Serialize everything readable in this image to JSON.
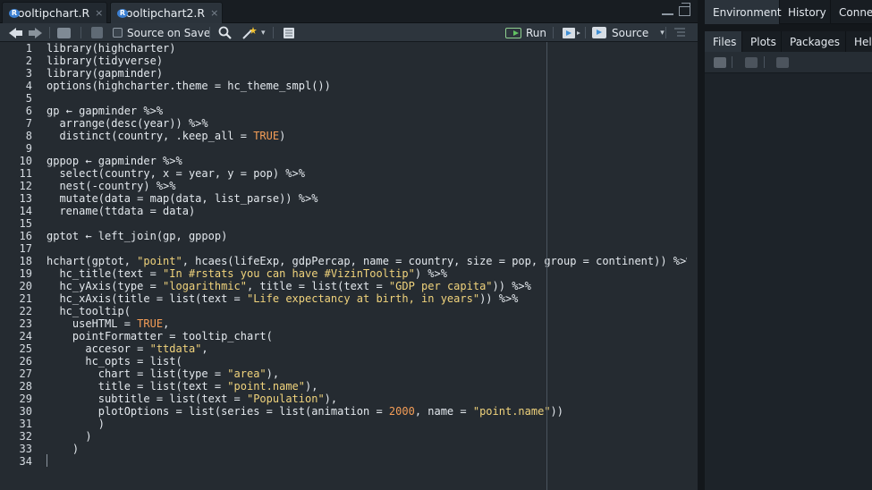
{
  "editor": {
    "tabs": [
      {
        "label": "tooltipchart.R",
        "close": "×"
      },
      {
        "label": "tooltipchart2.R",
        "close": "×"
      }
    ],
    "toolbar": {
      "source_on_save_label": "Source on Save",
      "run_label": "Run",
      "source_label": "Source",
      "source_caret": "▾"
    },
    "line_numbers": [
      "1",
      "2",
      "3",
      "4",
      "5",
      "6",
      "7",
      "8",
      "9",
      "10",
      "11",
      "12",
      "13",
      "14",
      "15",
      "16",
      "17",
      "18",
      "19",
      "20",
      "21",
      "22",
      "23",
      "24",
      "25",
      "26",
      "27",
      "28",
      "29",
      "30",
      "31",
      "32",
      "33",
      "34"
    ],
    "lines": [
      "library(highcharter)",
      "library(tidyverse)",
      "library(gapminder)",
      "options(highcharter.theme = hc_theme_smpl())",
      "",
      "gp ← gapminder %>%",
      "  arrange(desc(year)) %>%",
      "  distinct(country, .keep_all = TRUE)",
      "",
      "gppop ← gapminder %>%",
      "  select(country, x = year, y = pop) %>%",
      "  nest(-country) %>%",
      "  mutate(data = map(data, list_parse)) %>%",
      "  rename(ttdata = data)",
      "",
      "gptot ← left_join(gp, gppop)",
      "",
      "hchart(gptot, \"point\", hcaes(lifeExp, gdpPercap, name = country, size = pop, group = continent)) %>%",
      "  hc_title(text = \"In #rstats you can have #VizinTooltip\") %>%",
      "  hc_yAxis(type = \"logarithmic\", title = list(text = \"GDP per capita\")) %>%",
      "  hc_xAxis(title = list(text = \"Life expectancy at birth, in years\")) %>%",
      "  hc_tooltip(",
      "    useHTML = TRUE,",
      "    pointFormatter = tooltip_chart(",
      "      accesor = \"ttdata\",",
      "      hc_opts = list(",
      "        chart = list(type = \"area\"),",
      "        title = list(text = \"point.name\"),",
      "        subtitle = list(text = \"Population\"),",
      "        plotOptions = list(series = list(animation = 2000, name = \"point.name\"))",
      "        )",
      "      )",
      "    )",
      ""
    ]
  },
  "right_pane": {
    "top_tabs": [
      "Environment",
      "History",
      "Connections"
    ],
    "bottom_tabs": [
      "Files",
      "Plots",
      "Packages",
      "Help"
    ]
  },
  "colors": {
    "background": "#252b31",
    "string": "#f0d37c",
    "number": "#f39d57",
    "run_icon": "#62c462",
    "file_icon": "#3b7fd1"
  }
}
